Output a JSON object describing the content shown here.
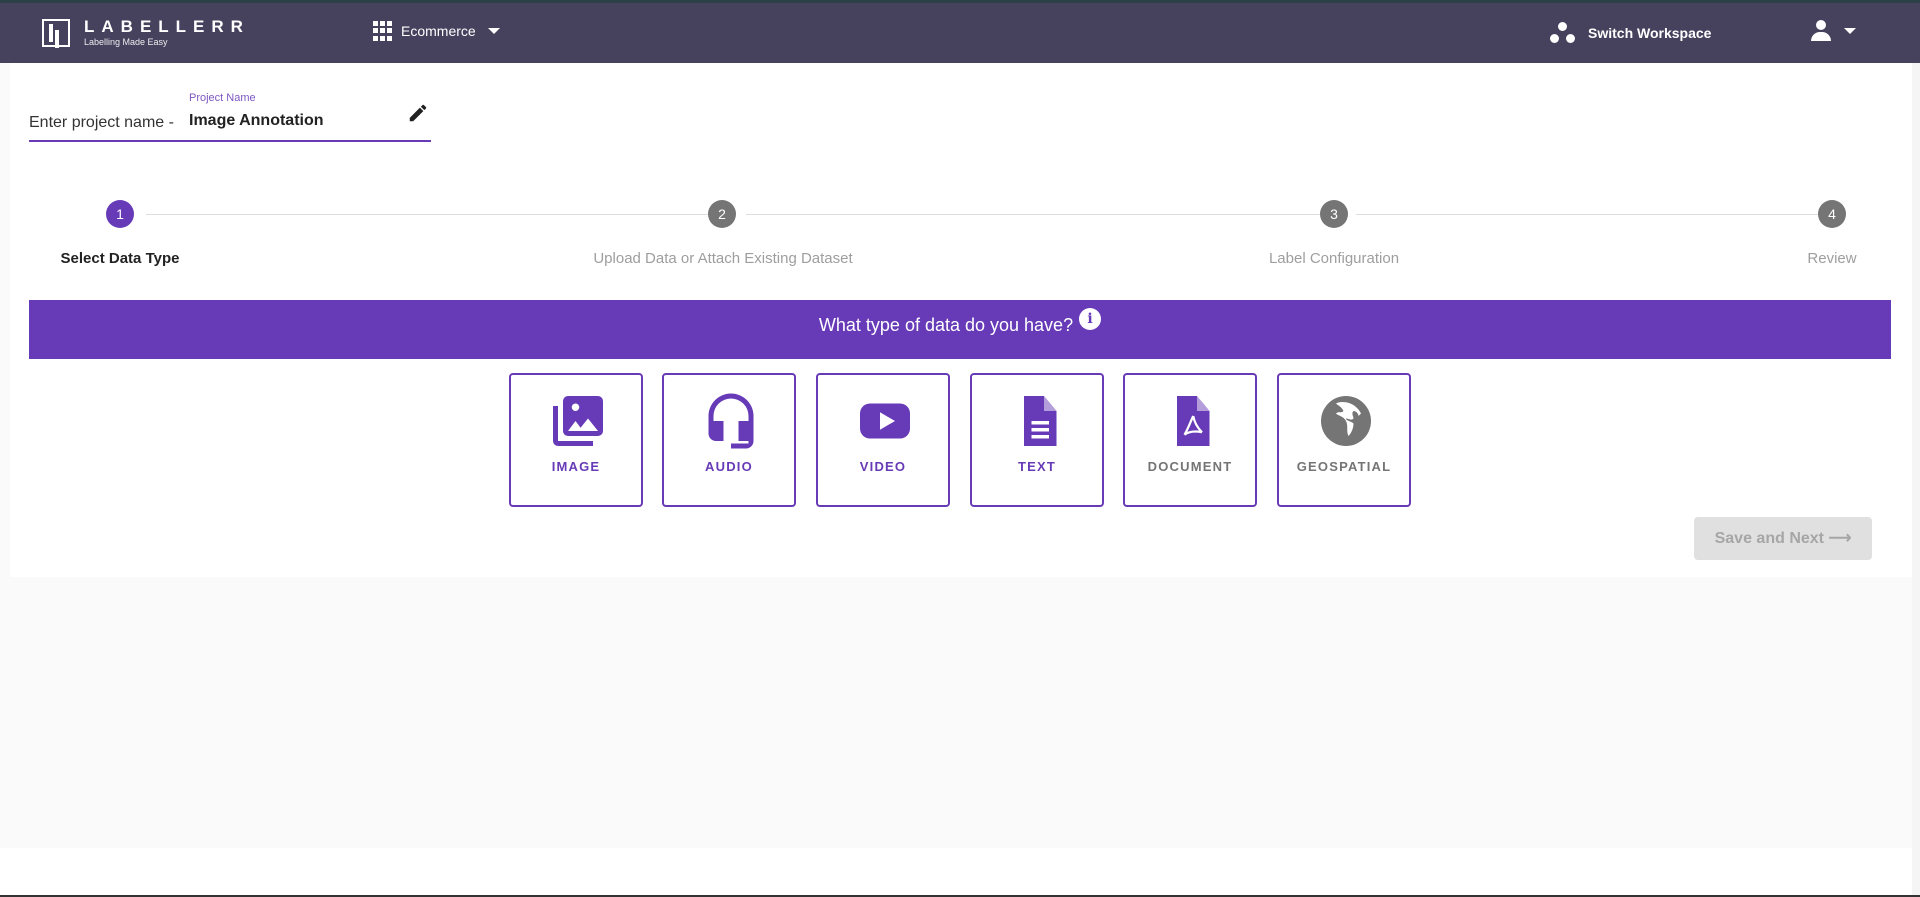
{
  "header": {
    "logo_name": "LABELLERR",
    "logo_tagline": "Labelling Made Easy",
    "workspace": "Ecommerce",
    "switch_workspace": "Switch Workspace"
  },
  "project": {
    "prefix": "Enter project name -",
    "label": "Project Name",
    "value": "Image Annotation"
  },
  "stepper": {
    "steps": [
      {
        "number": "1",
        "label": "Select Data Type",
        "active": true
      },
      {
        "number": "2",
        "label": "Upload Data or Attach Existing Dataset",
        "active": false
      },
      {
        "number": "3",
        "label": "Label Configuration",
        "active": false
      },
      {
        "number": "4",
        "label": "Review",
        "active": false
      }
    ]
  },
  "banner": {
    "question": "What type of data do you have?",
    "info_icon": "i"
  },
  "data_types": [
    {
      "label": "IMAGE",
      "icon": "image-collection-icon"
    },
    {
      "label": "AUDIO",
      "icon": "headset-icon"
    },
    {
      "label": "VIDEO",
      "icon": "play-video-icon"
    },
    {
      "label": "TEXT",
      "icon": "text-file-icon"
    },
    {
      "label": "DOCUMENT",
      "icon": "pdf-file-icon"
    },
    {
      "label": "GEOSPATIAL",
      "icon": "globe-icon"
    }
  ],
  "save_button": {
    "label": "Save and Next",
    "arrow": "⟶"
  },
  "colors": {
    "primary": "#673ab7",
    "header": "#46415d",
    "disabled": "#e0e0e0",
    "step_inactive": "#757575"
  }
}
